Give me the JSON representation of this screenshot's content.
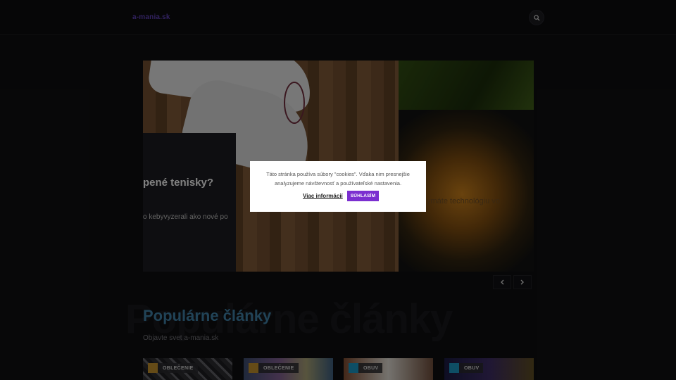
{
  "header": {
    "logo": "a-mania.sk",
    "search_icon": "search-icon"
  },
  "slider": {
    "slides": [
      {
        "title": "pené tenisky?",
        "excerpt": "o kebyvyzerali ako nové po"
      },
      {
        "title": "ymáte technológiu vo"
      }
    ],
    "prev_icon": "chevron-left-icon",
    "next_icon": "chevron-right-icon"
  },
  "section": {
    "background_title": "Populárne články",
    "title": "Populárne články",
    "subtitle": "Objavte svet a-mania.sk"
  },
  "cards": [
    {
      "category": "OBLEČENIE",
      "color": "#b8892a"
    },
    {
      "category": "OBLEČENIE",
      "color": "#b8892a"
    },
    {
      "category": "OBUV",
      "color": "#1a8fb8"
    },
    {
      "category": "OBUV",
      "color": "#1a8fb8"
    }
  ],
  "cookie": {
    "text": "Táto stránka používa súbory \"cookies\". Vďaka nim presnejšie analyzujeme návštevnosť a používateľské nastavenia.",
    "more_label": "Viac informácií",
    "accept_label": "SÚHLASÍM",
    "accept_color": "#7b2fd0"
  }
}
